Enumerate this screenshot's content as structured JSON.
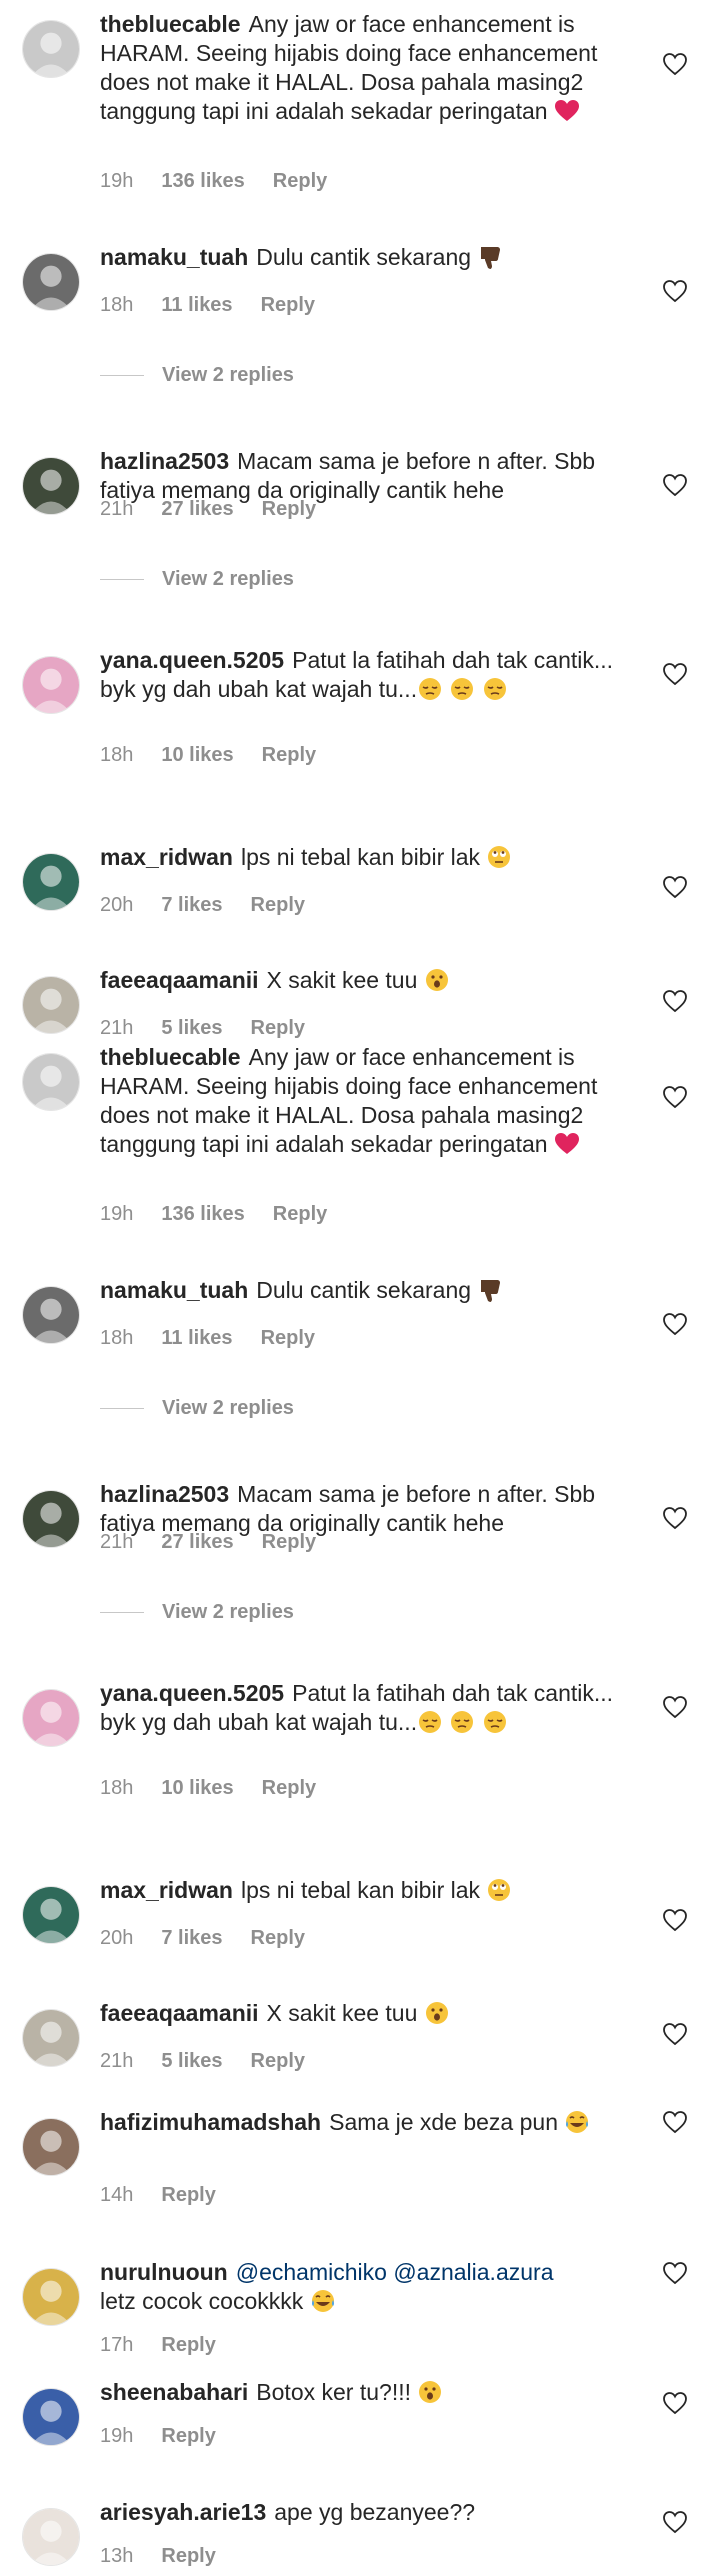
{
  "comments": [
    {
      "user": "thebluecable",
      "text": "Any jaw or face enhancement is HARAM. Seeing hijabis doing face enhancement does not make it HALAL. Dosa pahala masing2 tanggung tapi ini adalah sekadar peringatan",
      "emoji": "heart",
      "time": "19h",
      "likes": "136 likes",
      "reply": "Reply",
      "avatar_color": "#c9c9c9"
    },
    {
      "user": "namaku_tuah",
      "text": "Dulu cantik sekarang",
      "emoji": "thumbs-down",
      "time": "18h",
      "likes": "11 likes",
      "reply": "Reply",
      "view_replies": "View 2 replies",
      "avatar_color": "#6b6b6b"
    },
    {
      "user": "hazlina2503",
      "text": "Macam sama je before n after. Sbb fatiya memang da originally cantik hehe",
      "emoji": "",
      "time": "21h",
      "likes": "27 likes",
      "reply": "Reply",
      "view_replies": "View 2 replies",
      "avatar_color": "#3f4a3a"
    },
    {
      "user": "yana.queen.5205",
      "text": "Patut la fatihah dah tak cantik... byk yg dah ubah kat wajah tu...",
      "emoji": "pensive3",
      "time": "18h",
      "likes": "10 likes",
      "reply": "Reply",
      "avatar_color": "#e6a6c4"
    },
    {
      "user": "max_ridwan",
      "text": "lps ni tebal kan bibir lak",
      "emoji": "rolleyes",
      "time": "20h",
      "likes": "7 likes",
      "reply": "Reply",
      "avatar_color": "#2f6a5a"
    },
    {
      "user": "faeeaqaamanii",
      "text": "X sakit kee tuu",
      "emoji": "hushed",
      "time": "21h",
      "likes": "5 likes",
      "reply": "Reply",
      "avatar_color": "#b9b3a6"
    },
    {
      "user": "thebluecable",
      "text": "Any jaw or face enhancement is HARAM. Seeing hijabis doing face enhancement does not make it HALAL. Dosa pahala masing2 tanggung tapi ini adalah sekadar peringatan",
      "emoji": "heart",
      "time": "19h",
      "likes": "136 likes",
      "reply": "Reply",
      "avatar_color": "#c9c9c9"
    },
    {
      "user": "namaku_tuah",
      "text": "Dulu cantik sekarang",
      "emoji": "thumbs-down",
      "time": "18h",
      "likes": "11 likes",
      "reply": "Reply",
      "view_replies": "View 2 replies",
      "avatar_color": "#6b6b6b"
    },
    {
      "user": "hazlina2503",
      "text": "Macam sama je before n after. Sbb fatiya memang da originally cantik hehe",
      "emoji": "",
      "time": "21h",
      "likes": "27 likes",
      "reply": "Reply",
      "view_replies": "View 2 replies",
      "avatar_color": "#3f4a3a"
    },
    {
      "user": "yana.queen.5205",
      "text": "Patut la fatihah dah tak cantik... byk yg dah ubah kat wajah tu...",
      "emoji": "pensive3",
      "time": "18h",
      "likes": "10 likes",
      "reply": "Reply",
      "avatar_color": "#e6a6c4"
    },
    {
      "user": "max_ridwan",
      "text": "lps ni tebal kan bibir lak",
      "emoji": "rolleyes",
      "time": "20h",
      "likes": "7 likes",
      "reply": "Reply",
      "avatar_color": "#2f6a5a"
    },
    {
      "user": "faeeaqaamanii",
      "text": "X sakit kee tuu",
      "emoji": "hushed",
      "time": "21h",
      "likes": "5 likes",
      "reply": "Reply",
      "avatar_color": "#b9b3a6"
    },
    {
      "user": "hafizimuhamadshah",
      "text": "Sama je xde beza pun",
      "emoji": "joy",
      "time": "14h",
      "likes": "",
      "reply": "Reply",
      "avatar_color": "#8a6f5e"
    },
    {
      "user": "nurulnuoun",
      "text": "",
      "mentions": [
        "@echamichiko",
        "@aznalia.azura"
      ],
      "text2": "letz cocok cocokkkk",
      "emoji": "joy",
      "time": "17h",
      "likes": "",
      "reply": "Reply",
      "avatar_color": "#d8b24a"
    },
    {
      "user": "sheenabahari",
      "text": "Botox ker tu?!!!",
      "emoji": "hushed",
      "time": "19h",
      "likes": "",
      "reply": "Reply",
      "avatar_color": "#3a5fa8"
    },
    {
      "user": "ariesyah.arie13",
      "text": "ape yg bezanyee??",
      "emoji": "",
      "time": "13h",
      "likes": "",
      "reply": "Reply",
      "avatar_color": "#e9e2dc"
    }
  ]
}
